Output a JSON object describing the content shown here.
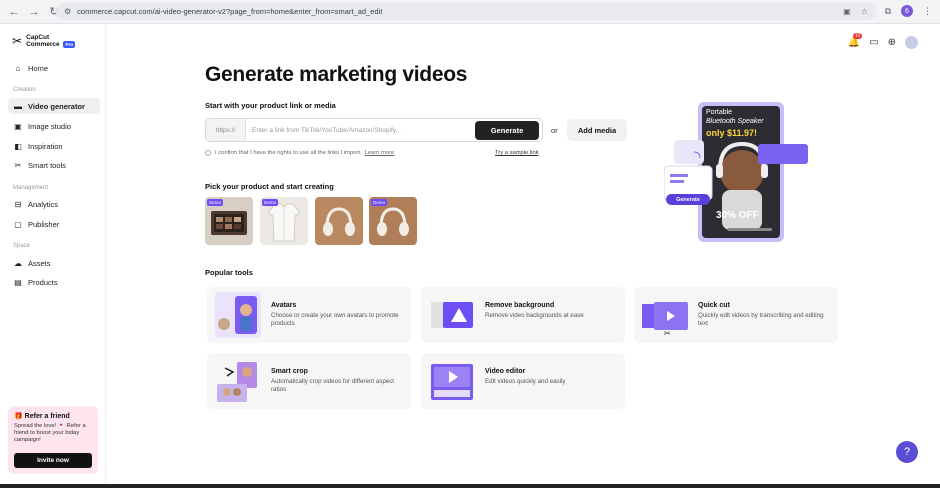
{
  "browser": {
    "url": "commerce.capcut.com/ai-video-generator-v2?page_from=home&enter_from=smart_ad_edit",
    "profile_initial": "6"
  },
  "brand": {
    "name_line1": "CapCut",
    "name_line2": "Commerce",
    "badge": "Pro"
  },
  "sidebar": {
    "home": "Home",
    "section_creation": "Creation",
    "video_generator": "Video generator",
    "image_studio": "Image studio",
    "inspiration": "Inspiration",
    "smart_tools": "Smart tools",
    "section_management": "Management",
    "analytics": "Analytics",
    "publisher": "Publisher",
    "section_space": "Space",
    "assets": "Assets",
    "products": "Products"
  },
  "refer": {
    "title": "Refer a friend",
    "desc": "Spread the love! 💌 Refer a friend to boost your biday campaign!",
    "button": "Invite now"
  },
  "header": {
    "notification_count": "10"
  },
  "main": {
    "title": "Generate marketing videos",
    "subhead": "Start with your product link or media",
    "protocol": "https://",
    "input_placeholder": "Enter a link from TikTok/YouTube/Amazon/Shopify...",
    "generate": "Generate",
    "or": "or",
    "add_media": "Add media",
    "consent": "I confirm that I have the rights to use all the links I import.",
    "learn_more": "Learn more",
    "sample": "Try a sample link",
    "pick_head": "Pick your product and start creating",
    "thumb_tag": "Demo"
  },
  "hero": {
    "line1": "Portable",
    "line2": "Bluetooth Speaker",
    "price": "only $11.97!",
    "discount": "30% OFF",
    "generate": "Generate"
  },
  "tools": {
    "heading": "Popular tools",
    "items": [
      {
        "title": "Avatars",
        "desc": "Choose or create your own avatars to promote products"
      },
      {
        "title": "Remove background",
        "desc": "Remove video backgrounds at ease"
      },
      {
        "title": "Quick cut",
        "desc": "Quickly edit videos by transcribing and editing text"
      },
      {
        "title": "Smart crop",
        "desc": "Automatically crop videos for different aspect ratios"
      },
      {
        "title": "Video editor",
        "desc": "Edit videos quickly and easily"
      }
    ]
  },
  "colors": {
    "accent": "#6c4df6",
    "primary_btn": "#222222",
    "refer_bg": "#fde4ef"
  }
}
